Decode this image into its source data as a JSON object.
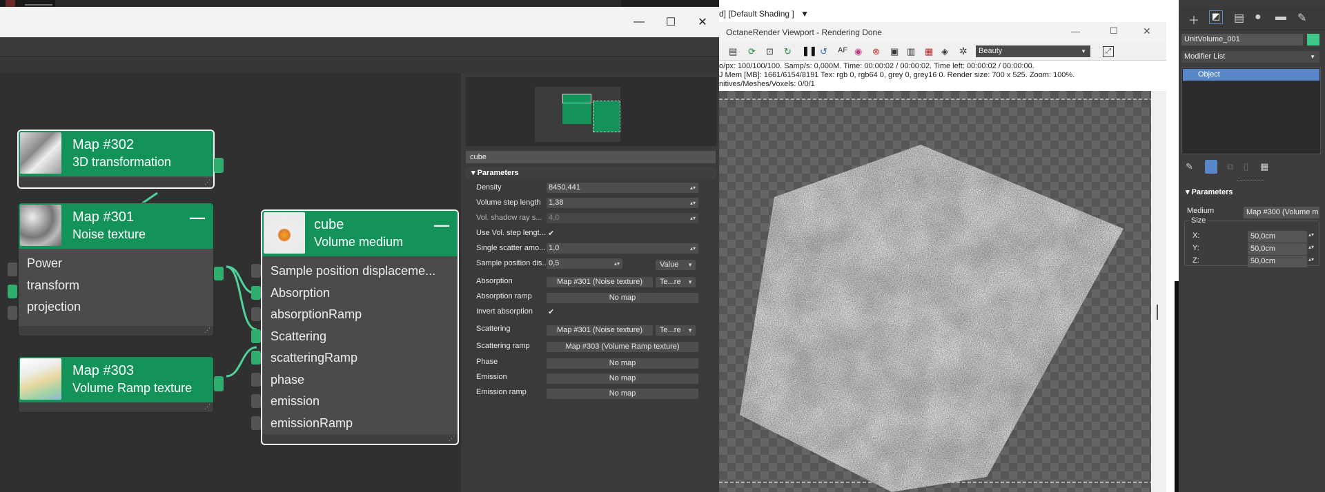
{
  "slate": {
    "title_controls": {
      "minimize": "—",
      "maximize": "☐",
      "close": "✕"
    }
  },
  "nodes": {
    "map302": {
      "title": "Map #302",
      "subtitle": "3D transformation"
    },
    "map301": {
      "title": "Map #301",
      "subtitle": "Noise texture",
      "collapse": "—",
      "inputs": [
        "Power",
        "transform",
        "projection"
      ]
    },
    "map303": {
      "title": "Map #303",
      "subtitle": "Volume Ramp texture"
    },
    "cube": {
      "title": "cube",
      "subtitle": "Volume medium",
      "collapse": "—",
      "inputs": [
        "Sample position displaceme...",
        "Absorption",
        "absorptionRamp",
        "Scattering",
        "scatteringRamp",
        "phase",
        "emission",
        "emissionRamp"
      ]
    }
  },
  "props": {
    "name": "cube",
    "section": "Parameters",
    "density": {
      "label": "Density",
      "value": "8450,441"
    },
    "volume_step": {
      "label": "Volume step length",
      "value": "1,38"
    },
    "vol_shadow": {
      "label": "Vol. shadow ray s...",
      "value": "4,0"
    },
    "use_vol_step": {
      "label": "Use Vol. step lengt..."
    },
    "single_scatter": {
      "label": "Single scatter amo...",
      "value": "1,0"
    },
    "sample_pos": {
      "label": "Sample position dis...",
      "value": "0,5",
      "mode": "Value"
    },
    "absorption": {
      "label": "Absorption",
      "value": "Map #301 (Noise texture)",
      "mode": "Te...re"
    },
    "absorption_ramp": {
      "label": "Absorption ramp",
      "value": "No map"
    },
    "invert_absorption": {
      "label": "Invert absorption"
    },
    "scattering": {
      "label": "Scattering",
      "value": "Map #301 (Noise texture)",
      "mode": "Te...re"
    },
    "scattering_ramp": {
      "label": "Scattering ramp",
      "value": "Map #303 (Volume Ramp texture)"
    },
    "phase": {
      "label": "Phase",
      "value": "No map"
    },
    "emission": {
      "label": "Emission",
      "value": "No map"
    },
    "emission_ramp": {
      "label": "Emission ramp",
      "value": "No map"
    }
  },
  "octane": {
    "viewport_label": "d] [Default Shading ]",
    "title": "OctaneRender Viewport - Rendering Done",
    "controls": {
      "minimize": "—",
      "maximize": "☐",
      "close": "✕"
    },
    "render_pass": "Beauty",
    "stats": [
      "o/px: 100/100/100.   Samp/s: 0,000M.   Time: 00:00:02 / 00:00:02.   Time left: 00:00:02 / 00:00:00.",
      "J Mem [MB]: 1661/6154/8191   Tex: rgb 0, rgb64 0, grey 0, grey16 0.   Render size: 700 x 525.   Zoom: 100%.",
      "nitives/Meshes/Voxels: 0/0/1"
    ]
  },
  "rightpanel": {
    "object_name": "UnitVolume_001",
    "modifier_list": "Modifier List",
    "stack_item": "Object",
    "section": "Parameters",
    "medium_label": "Medium",
    "medium_value": "Map #300 (Volume m",
    "size_label": "Size",
    "x_label": "X:",
    "x_value": "50,0cm",
    "y_label": "Y:",
    "y_value": "50,0cm",
    "z_label": "Z:",
    "z_value": "50,0cm"
  },
  "colors": {
    "node_header": "#13925a",
    "pin_green": "#2fae6e",
    "accent_blue": "#5a87c8",
    "object_color": "#3fc88a"
  }
}
